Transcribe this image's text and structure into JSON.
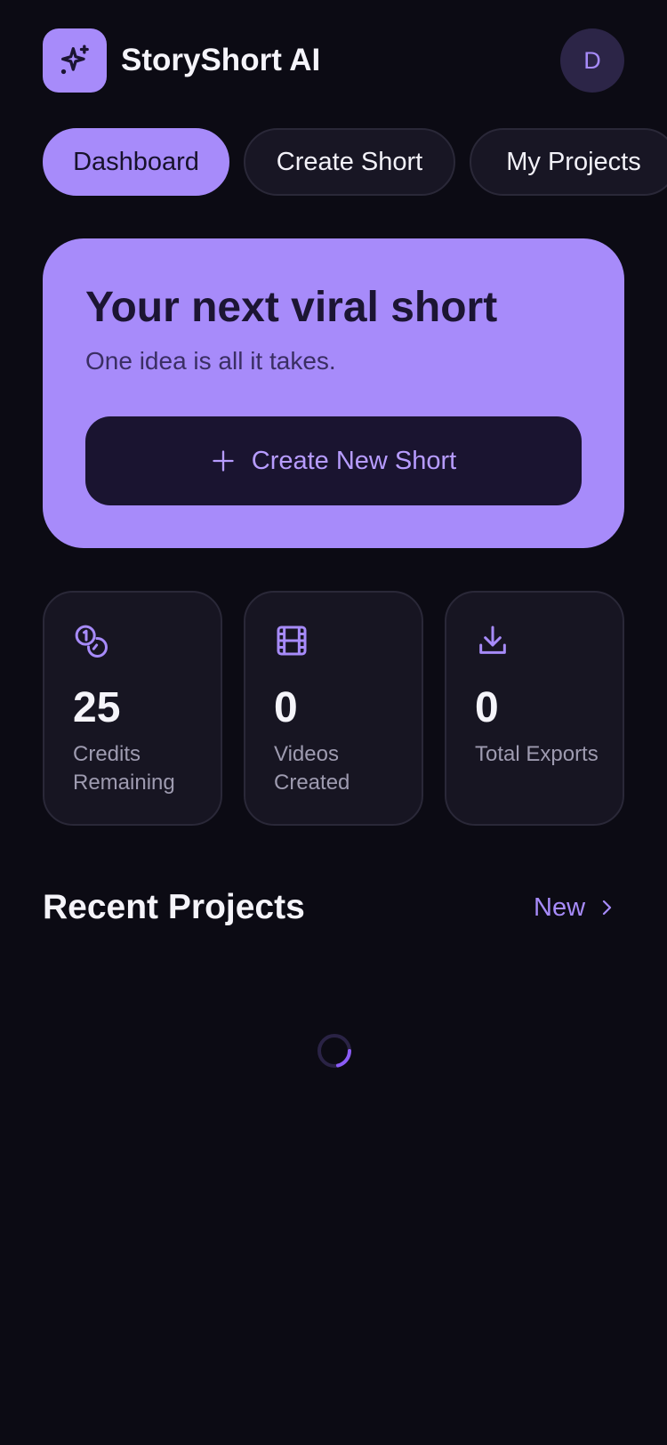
{
  "header": {
    "app_title": "StoryShort AI",
    "avatar_initial": "D",
    "logo_icon": "sparkles-icon"
  },
  "tabs": [
    {
      "label": "Dashboard",
      "active": true
    },
    {
      "label": "Create Short",
      "active": false
    },
    {
      "label": "My Projects",
      "active": false
    }
  ],
  "hero": {
    "title": "Your next viral short",
    "subtitle": "One idea is all it takes.",
    "button_label": "Create New Short",
    "button_icon": "plus-icon"
  },
  "stats": [
    {
      "value": "25",
      "label": "Credits Remaining",
      "icon": "coins-icon"
    },
    {
      "value": "0",
      "label": "Videos Created",
      "icon": "film-icon"
    },
    {
      "value": "0",
      "label": "Total Exports",
      "icon": "download-icon"
    }
  ],
  "recent_projects": {
    "title": "Recent Projects",
    "link_label": "New",
    "loading": true
  },
  "colors": {
    "background": "#0c0b14",
    "accent": "#a78bfa",
    "card": "#171522",
    "hero_button": "#1a1430"
  }
}
